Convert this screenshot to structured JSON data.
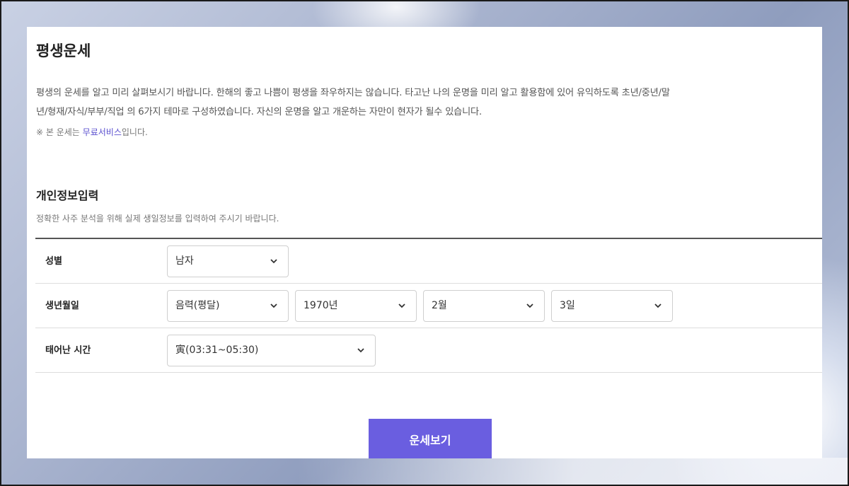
{
  "page": {
    "title": "평생운세",
    "intro_line1": "평생의 운세를 알고 미리 살펴보시기 바랍니다. 한해의 좋고 나쁨이 평생을 좌우하지는 않습니다. 타고난 나의 운명을 미리 알고 활용함에 있어 유익하도록 초년/중년/말",
    "intro_line2": "년/형재/자식/부부/직업 의 6가지 테마로 구성하였습니다. 자신의 운명을 알고 개운하는 자만이 현자가 될수 있습니다.",
    "notice_prefix": "※ 본 운세는 ",
    "notice_highlight": "무료서비스",
    "notice_suffix": "입니다."
  },
  "section": {
    "title": "개인정보입력",
    "description": "정확한 사주 분석을 위해 실제 생일정보를 입력하여 주시기 바랍니다."
  },
  "form": {
    "gender": {
      "label": "성별",
      "value": "남자"
    },
    "birthdate": {
      "label": "생년월일",
      "calendar": "음력(평달)",
      "year": "1970년",
      "month": "2월",
      "day": "3일"
    },
    "birth_time": {
      "label": "태어난 시간",
      "value": "寅(03:31~05:30)"
    }
  },
  "submit_label": "운세보기",
  "colors": {
    "accent": "#6a5ee0",
    "highlight_text": "#5a4fcf"
  },
  "icons": {
    "select_arrow": "chevron-down-icon"
  }
}
